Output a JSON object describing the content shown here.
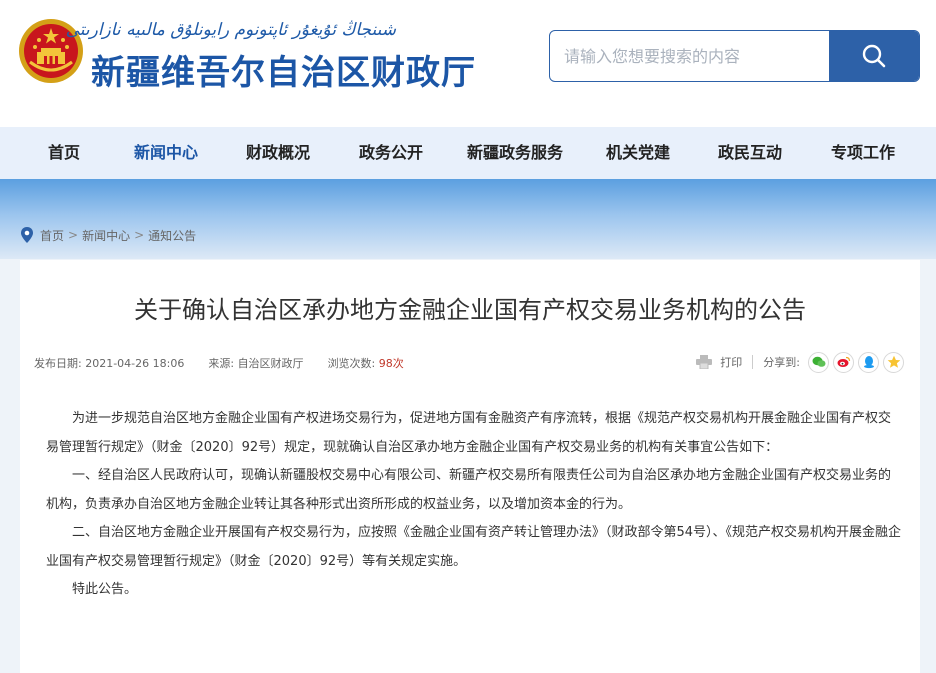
{
  "header": {
    "uyghur_name": "شىنجاڭ ئۇيغۇر ئاپتونوم رايونلۇق مالىيە نازارىتى",
    "site_title": "新疆维吾尔自治区财政厅"
  },
  "search": {
    "placeholder": "请输入您想要搜索的内容"
  },
  "nav": {
    "items": [
      {
        "label": "首页"
      },
      {
        "label": "新闻中心"
      },
      {
        "label": "财政概况"
      },
      {
        "label": "政务公开"
      },
      {
        "label": "新疆政务服务"
      },
      {
        "label": "机关党建"
      },
      {
        "label": "政民互动"
      },
      {
        "label": "专项工作"
      }
    ],
    "active_index": 1
  },
  "breadcrumb": {
    "items": [
      {
        "label": "首页"
      },
      {
        "label": "新闻中心"
      },
      {
        "label": "通知公告"
      }
    ],
    "separator": ">"
  },
  "article": {
    "title": "关于确认自治区承办地方金融企业国有产权交易业务机构的公告",
    "meta": {
      "date_label": "发布日期:",
      "date": "2021-04-26 18:06",
      "source_label": "来源:",
      "source": "自治区财政厅",
      "views_label": "浏览次数:",
      "views": "98次"
    },
    "print_label": "打印",
    "share_label": "分享到:",
    "paragraphs": [
      "为进一步规范自治区地方金融企业国有产权进场交易行为，促进地方国有金融资产有序流转，根据《规范产权交易机构开展金融企业国有产权交易管理暂行规定》（财金〔2020〕92号）规定，现就确认自治区承办地方金融企业国有产权交易业务的机构有关事宜公告如下：",
      "一、经自治区人民政府认可，现确认新疆股权交易中心有限公司、新疆产权交易所有限责任公司为自治区承办地方金融企业国有产权交易业务的机构，负责承办自治区地方金融企业转让其各种形式出资所形成的权益业务，以及增加资本金的行为。",
      "二、自治区地方金融企业开展国有产权交易行为，应按照《金融企业国有资产转让管理办法》（财政部令第54号）、《规范产权交易机构开展金融企业国有产权交易管理暂行规定》（财金〔2020〕92号）等有关规定实施。",
      "特此公告。"
    ]
  },
  "colors": {
    "brand_blue": "#1c56a6",
    "search_blue": "#2d61a8",
    "nav_bg": "#e8f0fb",
    "views_red": "#c0392b"
  },
  "icons": {
    "emblem": "national-emblem-icon",
    "search": "search-icon",
    "location": "location-pin-icon",
    "print": "printer-icon",
    "share": [
      "wechat-icon",
      "weibo-icon",
      "qq-icon",
      "qzone-icon"
    ]
  }
}
